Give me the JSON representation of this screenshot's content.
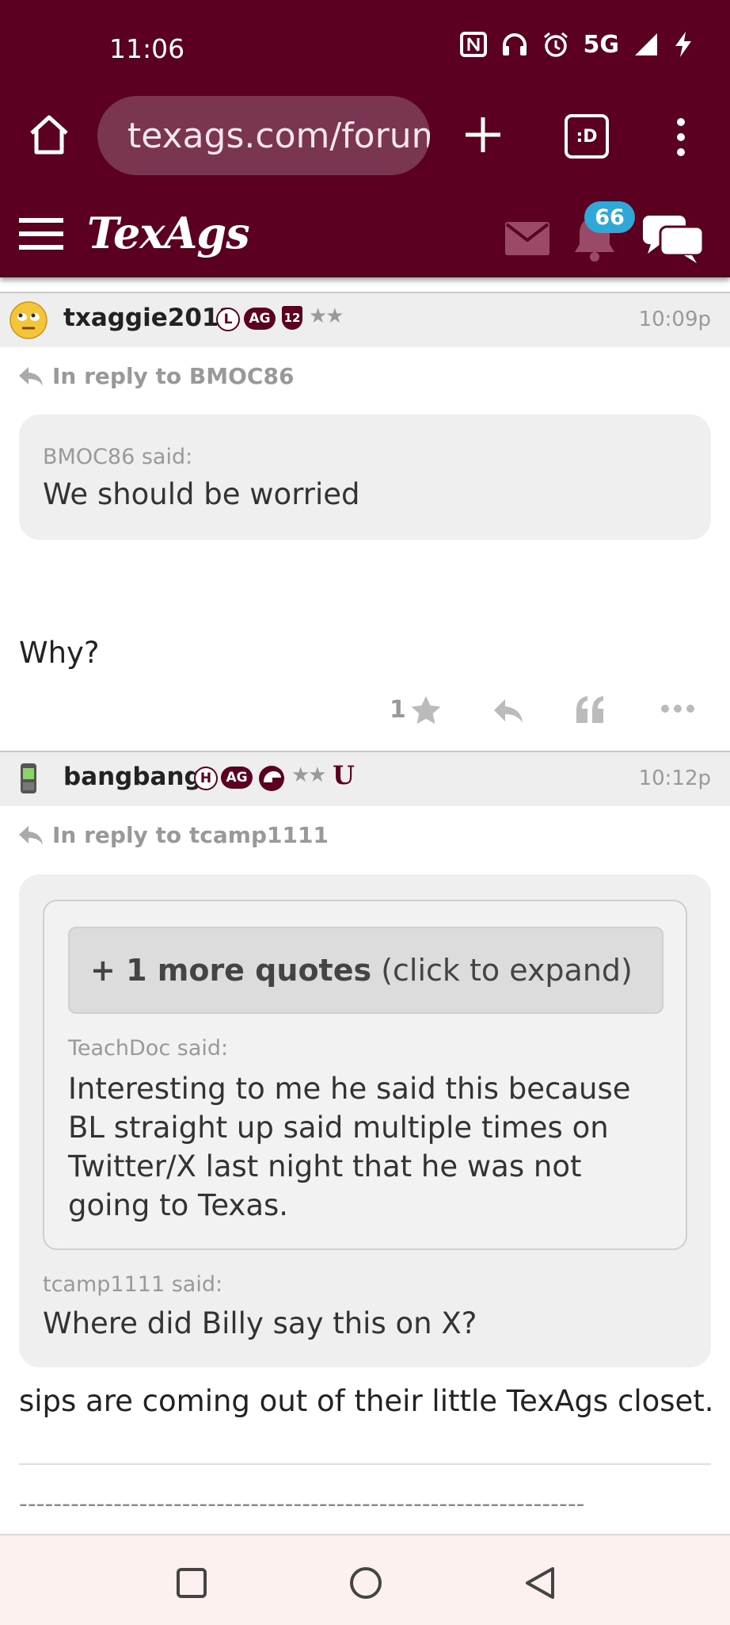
{
  "status_bar": {
    "time": "11:06",
    "network": "5G"
  },
  "browser": {
    "url": "texags.com/forum",
    "tab_icon_label": ":D"
  },
  "site": {
    "logo": "TexAgs",
    "notification_count": "66"
  },
  "posts": [
    {
      "username": "txaggie2012",
      "badges": [
        "L",
        "AG",
        "12"
      ],
      "stars": "★★",
      "time": "10:09p",
      "reply_to": "In reply to BMOC86",
      "quote": {
        "attribution": "BMOC86 said:",
        "text": "We should be worried"
      },
      "body": "Why?",
      "star_count": "1"
    },
    {
      "username": "bangbang",
      "badges": [
        "H",
        "AG"
      ],
      "stars": "★★",
      "extra_badge": "U",
      "time": "10:12p",
      "reply_to": "In reply to tcamp1111",
      "expand_bold": "+ 1 more quotes",
      "expand_rest": " (click to expand)",
      "nested_quote": {
        "attribution": "TeachDoc said:",
        "text": "Interesting to me he said this because BL straight up said multiple times on Twitter/X last night that he was not going to Texas."
      },
      "quote": {
        "attribution": "tcamp1111 said:",
        "text": "Where did Billy say this on X?"
      },
      "body": "sips are coming out of their little TexAgs closet.",
      "signature": "------------------------------------------------------------------"
    }
  ],
  "colors": {
    "brand": "#5c0022",
    "badge_blue": "#2fa8d8"
  },
  "icons": [
    "home-icon",
    "tune-icon",
    "plus-icon",
    "tabs-icon",
    "more-vert-icon",
    "hamburger-icon",
    "mail-icon",
    "bell-icon",
    "chat-icon",
    "reply-icon",
    "star-icon",
    "quote-icon",
    "more-horiz-icon",
    "square-icon",
    "circle-icon",
    "back-triangle-icon"
  ]
}
